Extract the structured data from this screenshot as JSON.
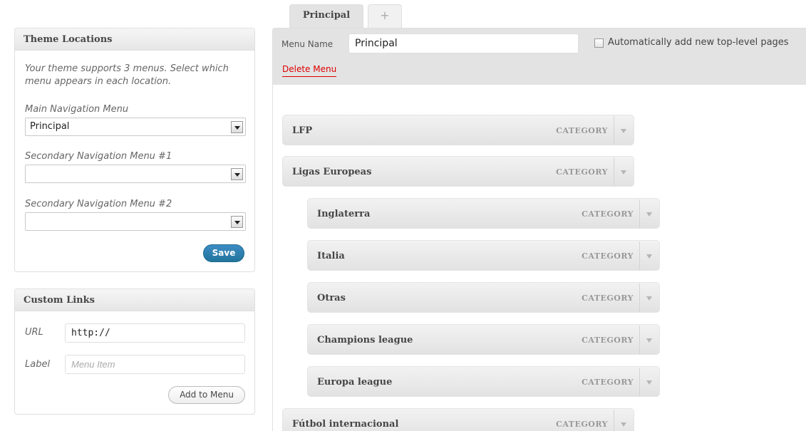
{
  "theme_locations": {
    "title": "Theme Locations",
    "description": "Your theme supports 3 menus. Select which menu appears in each location.",
    "locations": [
      {
        "label": "Main Navigation Menu",
        "value": "Principal"
      },
      {
        "label": "Secondary Navigation Menu #1",
        "value": ""
      },
      {
        "label": "Secondary Navigation Menu #2",
        "value": ""
      }
    ],
    "save_label": "Save"
  },
  "custom_links": {
    "title": "Custom Links",
    "url_label": "URL",
    "url_value": "http://",
    "label_label": "Label",
    "label_placeholder": "Menu Item",
    "add_label": "Add to Menu"
  },
  "tabs": {
    "active": "Principal",
    "add": "+"
  },
  "menu_header": {
    "name_label": "Menu Name",
    "name_value": "Principal",
    "auto_add_label": "Automatically add new top-level pages",
    "auto_add_checked": false,
    "delete_label": "Delete Menu"
  },
  "menu_items": [
    {
      "title": "LFP",
      "type": "CATEGORY",
      "depth": 0
    },
    {
      "title": "Ligas Europeas",
      "type": "CATEGORY",
      "depth": 0
    },
    {
      "title": "Inglaterra",
      "type": "CATEGORY",
      "depth": 1
    },
    {
      "title": "Italia",
      "type": "CATEGORY",
      "depth": 1
    },
    {
      "title": "Otras",
      "type": "CATEGORY",
      "depth": 1
    },
    {
      "title": "Champions league",
      "type": "CATEGORY",
      "depth": 1
    },
    {
      "title": "Europa league",
      "type": "CATEGORY",
      "depth": 1
    },
    {
      "title": "Fútbol internacional",
      "type": "CATEGORY",
      "depth": 0
    }
  ],
  "colors": {
    "delete_link": "#dd0000",
    "primary_button": "#21759b"
  }
}
